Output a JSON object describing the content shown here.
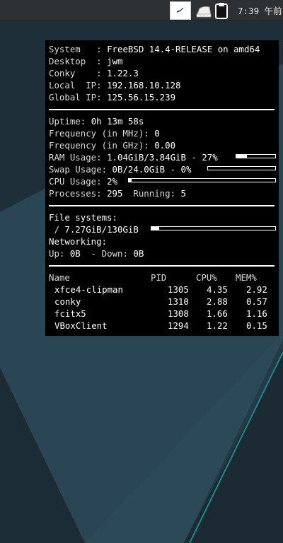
{
  "colors": {
    "desktop_dark": "#1f2e36",
    "desktop_teal": "#2a4d5a",
    "accent_teal": "#1a8a8a",
    "conky_bg": "#000000",
    "conky_fg": "#ffffff",
    "panel_bg": "#2e3133"
  },
  "panel": {
    "icons": [
      "clock-icon",
      "usb-device-icon",
      "clipboard-icon"
    ],
    "clock": "7:39 午前"
  },
  "conky": {
    "system": [
      {
        "label": "System   ",
        "value": "FreeBSD 14.4-RELEASE on amd64"
      },
      {
        "label": "Desktop  ",
        "value": "jwm"
      },
      {
        "label": "Conky    ",
        "value": "1.22.3"
      },
      {
        "label": "Local  IP",
        "value": "192.168.10.128"
      },
      {
        "label": "Global IP",
        "value": "125.56.15.239"
      }
    ],
    "uptime": {
      "label": "Uptime: ",
      "value": "0h 13m 58s"
    },
    "freq_mhz": {
      "label": "Frequency (in MHz): ",
      "value": "0"
    },
    "freq_ghz": {
      "label": "Frequency (in GHz): ",
      "value": "0.00"
    },
    "ram": {
      "label": "RAM Usage: ",
      "value": "1.04GiB/3.84GiB - 27%",
      "percent": 27
    },
    "swap": {
      "label": "Swap Usage: ",
      "value": "0B/24.0GiB - 0%",
      "percent": 0
    },
    "cpu": {
      "label": "CPU Usage: ",
      "value": "2%",
      "percent": 2
    },
    "processes": {
      "label": "Processes: ",
      "value": "295",
      "running_label": "Running: ",
      "running_value": "5"
    },
    "filesystems": {
      "label": "File systems:",
      "root": {
        "mount": " / ",
        "value": "7.27GiB/130GiB",
        "percent": 6
      }
    },
    "networking": {
      "label": "Networking:",
      "up_label": "Up: ",
      "up_value": "0B",
      "down_label": "  - Down: ",
      "down_value": "0B"
    },
    "process_table": {
      "headers": {
        "name": "Name",
        "pid": "PID",
        "cpu": "CPU%",
        "mem": "MEM%"
      },
      "rows": [
        {
          "name": "xfce4-clipman",
          "pid": "1305",
          "cpu": "4.35",
          "mem": "2.92"
        },
        {
          "name": "conky",
          "pid": "1310",
          "cpu": "2.88",
          "mem": "0.57"
        },
        {
          "name": "fcitx5",
          "pid": "1308",
          "cpu": "1.66",
          "mem": "1.16"
        },
        {
          "name": "VBoxClient",
          "pid": "1294",
          "cpu": "1.22",
          "mem": "0.15"
        }
      ]
    }
  }
}
